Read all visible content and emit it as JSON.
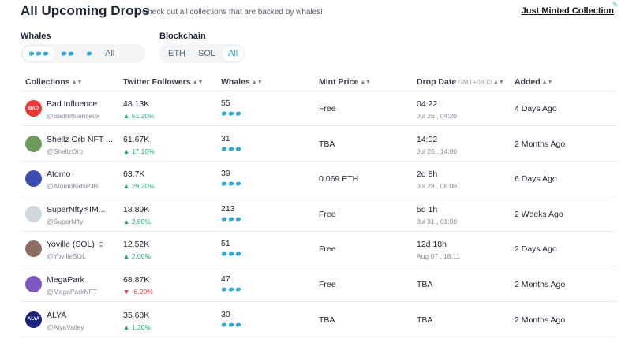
{
  "header": {
    "title": "All Upcoming Drops",
    "subtitle": "Check out all collections that are backed by whales!",
    "just_minted_label": "Just Minted Collection"
  },
  "filters": {
    "whales_label": "Whales",
    "whales_options": [
      "3 whales",
      "2 whales",
      "1 whale",
      "All"
    ],
    "whales_all_label": "All",
    "blockchain_label": "Blockchain",
    "blockchain_options": [
      "ETH",
      "SOL",
      "All"
    ],
    "blockchain_selected": "All"
  },
  "colors": {
    "accent": "#2ba6d6",
    "up": "#1fae7c",
    "down": "#e03c3c"
  },
  "table": {
    "columns": {
      "collections": "Collections",
      "twitter_followers": "Twitter Followers",
      "whales": "Whales",
      "mint_price": "Mint Price",
      "drop_date": "Drop Date",
      "drop_date_tz": "GMT+0800",
      "added": "Added"
    },
    "rows": [
      {
        "name": "Bad Influence",
        "handle": "@BadInfluence0x",
        "followers": "48.13K",
        "change": "▲ 51.20%",
        "trend": "up",
        "whales": "55",
        "whale_icons": 3,
        "mint_price": "Free",
        "drop_date": "04:22",
        "drop_date_sub": "Jul 26 , 04:20",
        "added": "4 Days Ago",
        "avatar_text": "BAD",
        "avatar_color": "#e53935"
      },
      {
        "name": "Shellz Orb NFT ...",
        "handle": "@ShellzOrb",
        "followers": "61.67K",
        "change": "▲ 17.10%",
        "trend": "up",
        "whales": "31",
        "whale_icons": 3,
        "mint_price": "TBA",
        "drop_date": "14:02",
        "drop_date_sub": "Jul 26 , 14:00",
        "added": "2 Months Ago",
        "avatar_text": "",
        "avatar_color": "#6f9a5e"
      },
      {
        "name": "Atomo",
        "handle": "@AtomoKidsPJB",
        "followers": "63.7K",
        "change": "▲ 29.20%",
        "trend": "up",
        "whales": "39",
        "whale_icons": 3,
        "mint_price": "0.069 ETH",
        "drop_date": "2d 8h",
        "drop_date_sub": "Jul 28 , 08:00",
        "added": "6 Days Ago",
        "avatar_text": "",
        "avatar_color": "#3c4fb0"
      },
      {
        "name": "SuperNfty⚡IM...",
        "handle": "@SuperNfty",
        "followers": "18.89K",
        "change": "▲ 2.80%",
        "trend": "up",
        "whales": "213",
        "whale_icons": 3,
        "mint_price": "Free",
        "drop_date": "5d 1h",
        "drop_date_sub": "Jul 31 , 01:00",
        "added": "2 Weeks Ago",
        "avatar_text": "",
        "avatar_color": "#cfd8dc"
      },
      {
        "name": "Yoville (SOL) ☺",
        "handle": "@YovilleSOL",
        "followers": "12.52K",
        "change": "▲ 2.00%",
        "trend": "up",
        "whales": "51",
        "whale_icons": 3,
        "mint_price": "Free",
        "drop_date": "12d 18h",
        "drop_date_sub": "Aug 07 , 18:11",
        "added": "2 Days Ago",
        "avatar_text": "",
        "avatar_color": "#8d6e63"
      },
      {
        "name": "MegaPark",
        "handle": "@MegaParkNFT",
        "followers": "68.87K",
        "change": "▼ -6.20%",
        "trend": "down",
        "whales": "47",
        "whale_icons": 3,
        "mint_price": "Free",
        "drop_date": "TBA",
        "drop_date_sub": "",
        "added": "2 Months Ago",
        "avatar_text": "",
        "avatar_color": "#7e57c2"
      },
      {
        "name": "ALYA",
        "handle": "@AlyaValley",
        "followers": "35.68K",
        "change": "▲ 1.30%",
        "trend": "up",
        "whales": "30",
        "whale_icons": 3,
        "mint_price": "TBA",
        "drop_date": "TBA",
        "drop_date_sub": "",
        "added": "2 Months Ago",
        "avatar_text": "ALYA",
        "avatar_color": "#1a237e"
      }
    ]
  }
}
